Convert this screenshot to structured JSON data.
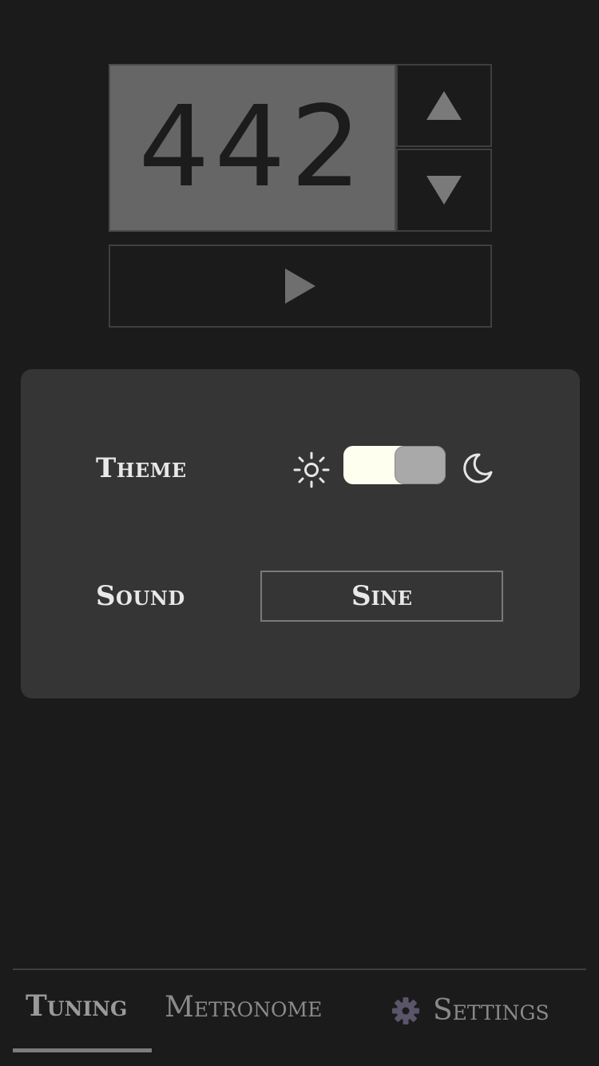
{
  "tuner": {
    "frequency": "442",
    "step_up_icon": "triangle-up-icon",
    "step_down_icon": "triangle-down-icon",
    "play_icon": "play-icon"
  },
  "settings": {
    "theme_label": "Theme",
    "theme_light_icon": "sun-icon",
    "theme_dark_icon": "moon-icon",
    "theme_toggle_state": "dark",
    "sound_label": "Sound",
    "sound_value": "Sine"
  },
  "nav": {
    "tuning": "Tuning",
    "metronome": "Metronome",
    "settings": "Settings",
    "settings_icon": "gear-icon",
    "active": "tuning"
  },
  "colors": {
    "background": "#1b1b1b",
    "panel": "#353535",
    "display": "#666666",
    "toggle_track": "#fffff0",
    "toggle_knob": "#a9a9a9"
  }
}
